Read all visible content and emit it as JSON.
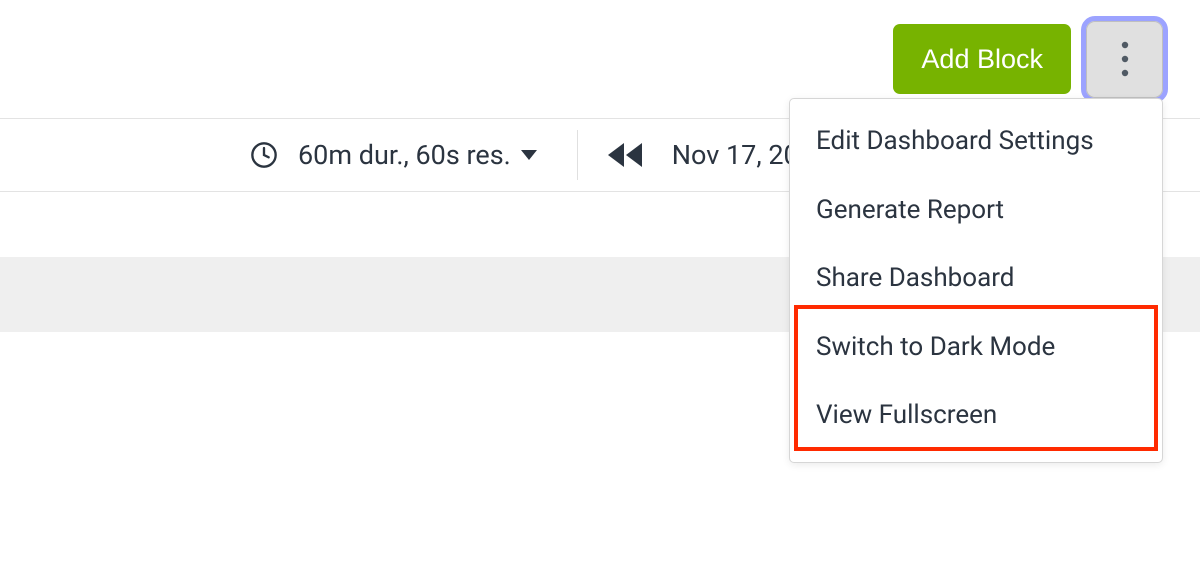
{
  "header": {
    "add_block_label": "Add Block"
  },
  "toolbar": {
    "range_label": "60m dur., 60s res.",
    "date_label": "Nov 17, 20"
  },
  "menu": {
    "items": [
      "Edit Dashboard Settings",
      "Generate Report",
      "Share Dashboard",
      "Switch to Dark Mode",
      "View Fullscreen"
    ]
  }
}
